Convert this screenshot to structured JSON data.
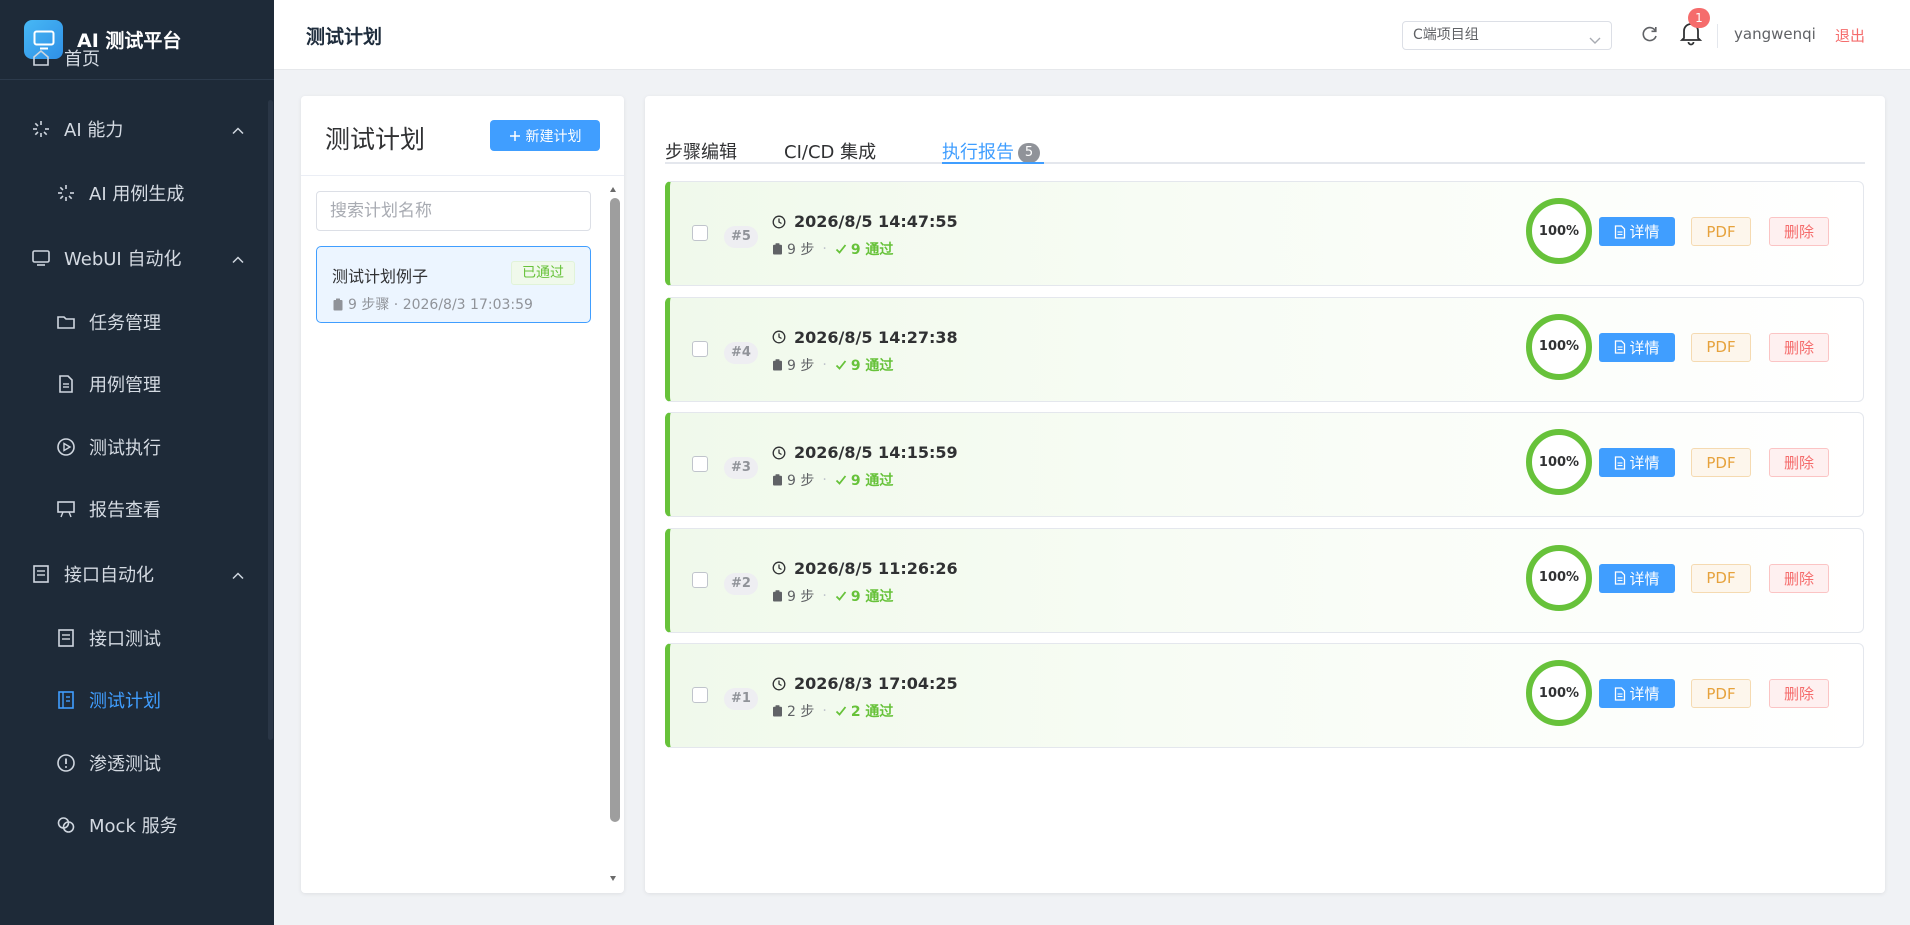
{
  "sidebar": {
    "brand": "AI 测试平台",
    "items": [
      {
        "label": "首页"
      },
      {
        "label": "AI 能力"
      },
      {
        "label": "AI 用例生成"
      },
      {
        "label": "WebUI 自动化"
      },
      {
        "label": "任务管理"
      },
      {
        "label": "用例管理"
      },
      {
        "label": "测试执行"
      },
      {
        "label": "报告查看"
      },
      {
        "label": "接口自动化"
      },
      {
        "label": "接口测试"
      },
      {
        "label": "测试计划"
      },
      {
        "label": "渗透测试"
      },
      {
        "label": "Mock 服务"
      }
    ]
  },
  "header": {
    "title": "测试计划",
    "project": "C端项目组",
    "notifications": "1",
    "username": "yangwenqi",
    "logout": "退出"
  },
  "plans": {
    "title": "测试计划",
    "new_button": "新建计划",
    "search_placeholder": "搜索计划名称",
    "items": [
      {
        "name": "测试计划例子",
        "status": "已通过",
        "meta": "9 步骤 · 2026/8/3 17:03:59"
      }
    ]
  },
  "tabs": {
    "steps": "步骤编辑",
    "cicd": "CI/CD 集成",
    "reports": "执行报告",
    "reports_count": "5"
  },
  "reports": [
    {
      "num": "#5",
      "time": "2026/8/5 14:47:55",
      "steps": "9 步",
      "passed": "9 通过",
      "rate": "100%"
    },
    {
      "num": "#4",
      "time": "2026/8/5 14:27:38",
      "steps": "9 步",
      "passed": "9 通过",
      "rate": "100%"
    },
    {
      "num": "#3",
      "time": "2026/8/5 14:15:59",
      "steps": "9 步",
      "passed": "9 通过",
      "rate": "100%"
    },
    {
      "num": "#2",
      "time": "2026/8/5 11:26:26",
      "steps": "9 步",
      "passed": "9 通过",
      "rate": "100%"
    },
    {
      "num": "#1",
      "time": "2026/8/3 17:04:25",
      "steps": "2 步",
      "passed": "2 通过",
      "rate": "100%"
    }
  ],
  "report_actions": {
    "detail": "详情",
    "pdf": "PDF",
    "delete": "删除"
  },
  "colors": {
    "primary": "#409eff",
    "success": "#67c23a",
    "warning": "#e6a23c",
    "danger": "#f56c6c",
    "sidebar_bg": "#1e2a38"
  }
}
